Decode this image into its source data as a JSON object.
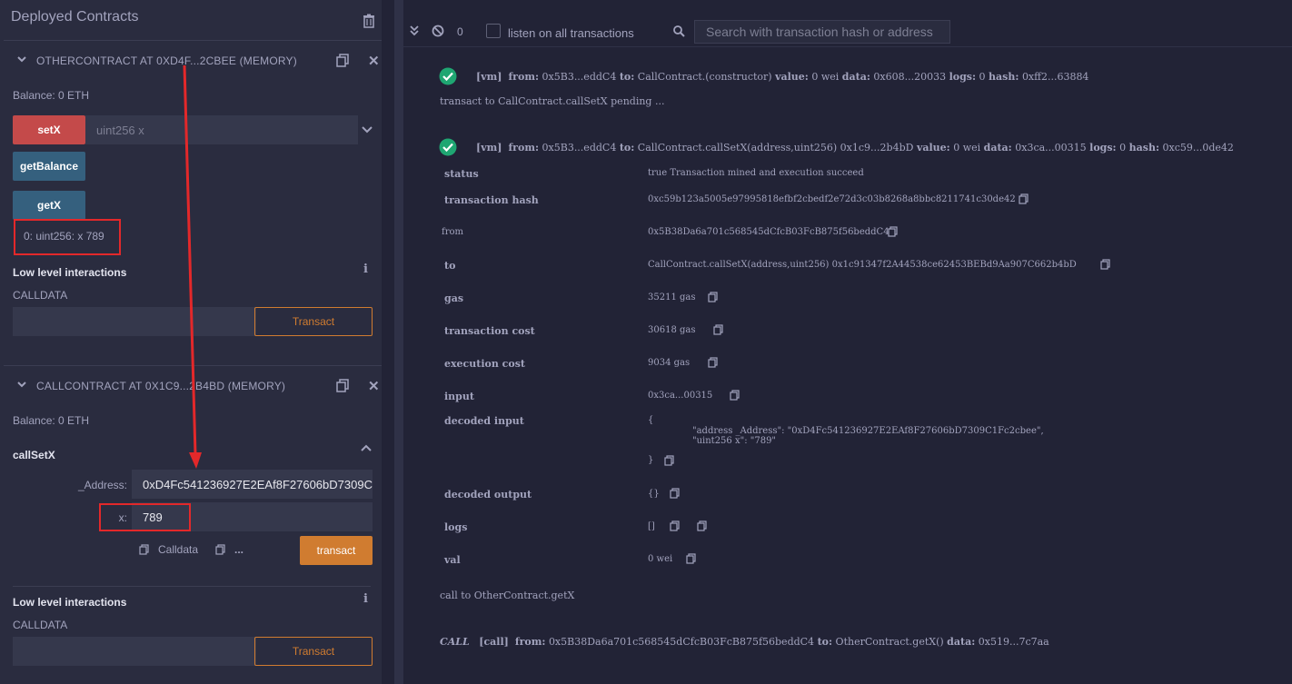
{
  "left_panel": {
    "title": "Deployed Contracts",
    "contracts": [
      {
        "name": "OTHERCONTRACT AT 0XD4F...2CBEE (MEMORY)",
        "balance": "Balance: 0 ETH",
        "buttons": {
          "setX": "setX",
          "setX_placeholder": "uint256 x",
          "getBalance": "getBalance",
          "getX": "getX"
        },
        "result": "0: uint256: x 789",
        "low_level": "Low level interactions",
        "calldata_label": "CALLDATA",
        "transact": "Transact"
      },
      {
        "name": "CALLCONTRACT AT 0X1C9...2B4BD (MEMORY)",
        "balance": "Balance: 0 ETH",
        "function_title": "callSetX",
        "address_label": "_Address:",
        "address_value": "0xD4Fc541236927E2EAf8F27606bD7309C",
        "x_label": "x:",
        "x_value": "789",
        "calldata_btn": "Calldata",
        "more": "...",
        "transact_btn": "transact",
        "low_level": "Low level interactions",
        "calldata_label": "CALLDATA",
        "transact": "Transact"
      }
    ]
  },
  "toolbar": {
    "count": "0",
    "listen_label": "listen on all transactions",
    "search_placeholder": "Search with transaction hash or address"
  },
  "terminal": {
    "tx1": {
      "tag": "[vm]",
      "from_kw": "from:",
      "from": "0x5B3...eddC4",
      "to_kw": "to:",
      "to": "CallContract.(constructor)",
      "value_kw": "value:",
      "value": "0 wei",
      "data_kw": "data:",
      "data": "0x608...20033",
      "logs_kw": "logs:",
      "logs": "0",
      "hash_kw": "hash:",
      "hash": "0xff2...63884"
    },
    "pending": "transact to CallContract.callSetX pending ...",
    "tx2": {
      "tag": "[vm]",
      "from_kw": "from:",
      "from": "0x5B3...eddC4",
      "to_kw": "to:",
      "to": "CallContract.callSetX(address,uint256) 0x1c9...2b4bD",
      "value_kw": "value:",
      "value": "0 wei",
      "data_kw": "data:",
      "data": "0x3ca...00315",
      "logs_kw": "logs:",
      "logs": "0",
      "hash_kw": "hash:",
      "hash": "0xc59...0de42"
    },
    "details": {
      "status_label": "status",
      "status": "true Transaction mined and execution succeed",
      "hash_label": "transaction hash",
      "hash": "0xc59b123a5005e97995818efbf2cbedf2e72d3c03b8268a8bbc8211741c30de42",
      "from_label": "from",
      "from": "0x5B38Da6a701c568545dCfcB03FcB875f56beddC4",
      "to_label": "to",
      "to": "CallContract.callSetX(address,uint256) 0x1c91347f2A44538ce62453BEBd9Aa907C662b4bD",
      "gas_label": "gas",
      "gas": "35211 gas",
      "tx_cost_label": "transaction cost",
      "tx_cost": "30618 gas",
      "exec_cost_label": "execution cost",
      "exec_cost": "9034 gas",
      "input_label": "input",
      "input": "0x3ca...00315",
      "decoded_input_label": "decoded input",
      "decoded_open": "{",
      "decoded_line1": "\"address _Address\": \"0xD4Fc541236927E2EAf8F27606bD7309C1Fc2cbee\",",
      "decoded_line2": "\"uint256 x\": \"789\"",
      "decoded_close": "}",
      "decoded_output_label": "decoded output",
      "decoded_output": "{}",
      "logs_label": "logs",
      "logs": "[]",
      "val_label": "val",
      "val": "0 wei"
    },
    "call_to": "call to OtherContract.getX",
    "call": {
      "badge": "CALL",
      "tag": "[call]",
      "from_kw": "from:",
      "from": "0x5B38Da6a701c568545dCfcB03FcB875f56beddC4",
      "to_kw": "to:",
      "to": "OtherContract.getX()",
      "data_kw": "data:",
      "data": "0x519...7c7aa"
    }
  },
  "colors": {
    "panel_bg": "#2a2c3f",
    "terminal_bg": "#222336",
    "red_btn": "#c44a4a",
    "blue_btn": "#35607e",
    "orange": "#d07c30",
    "success": "#1fa672",
    "annotation": "#e3282a"
  }
}
